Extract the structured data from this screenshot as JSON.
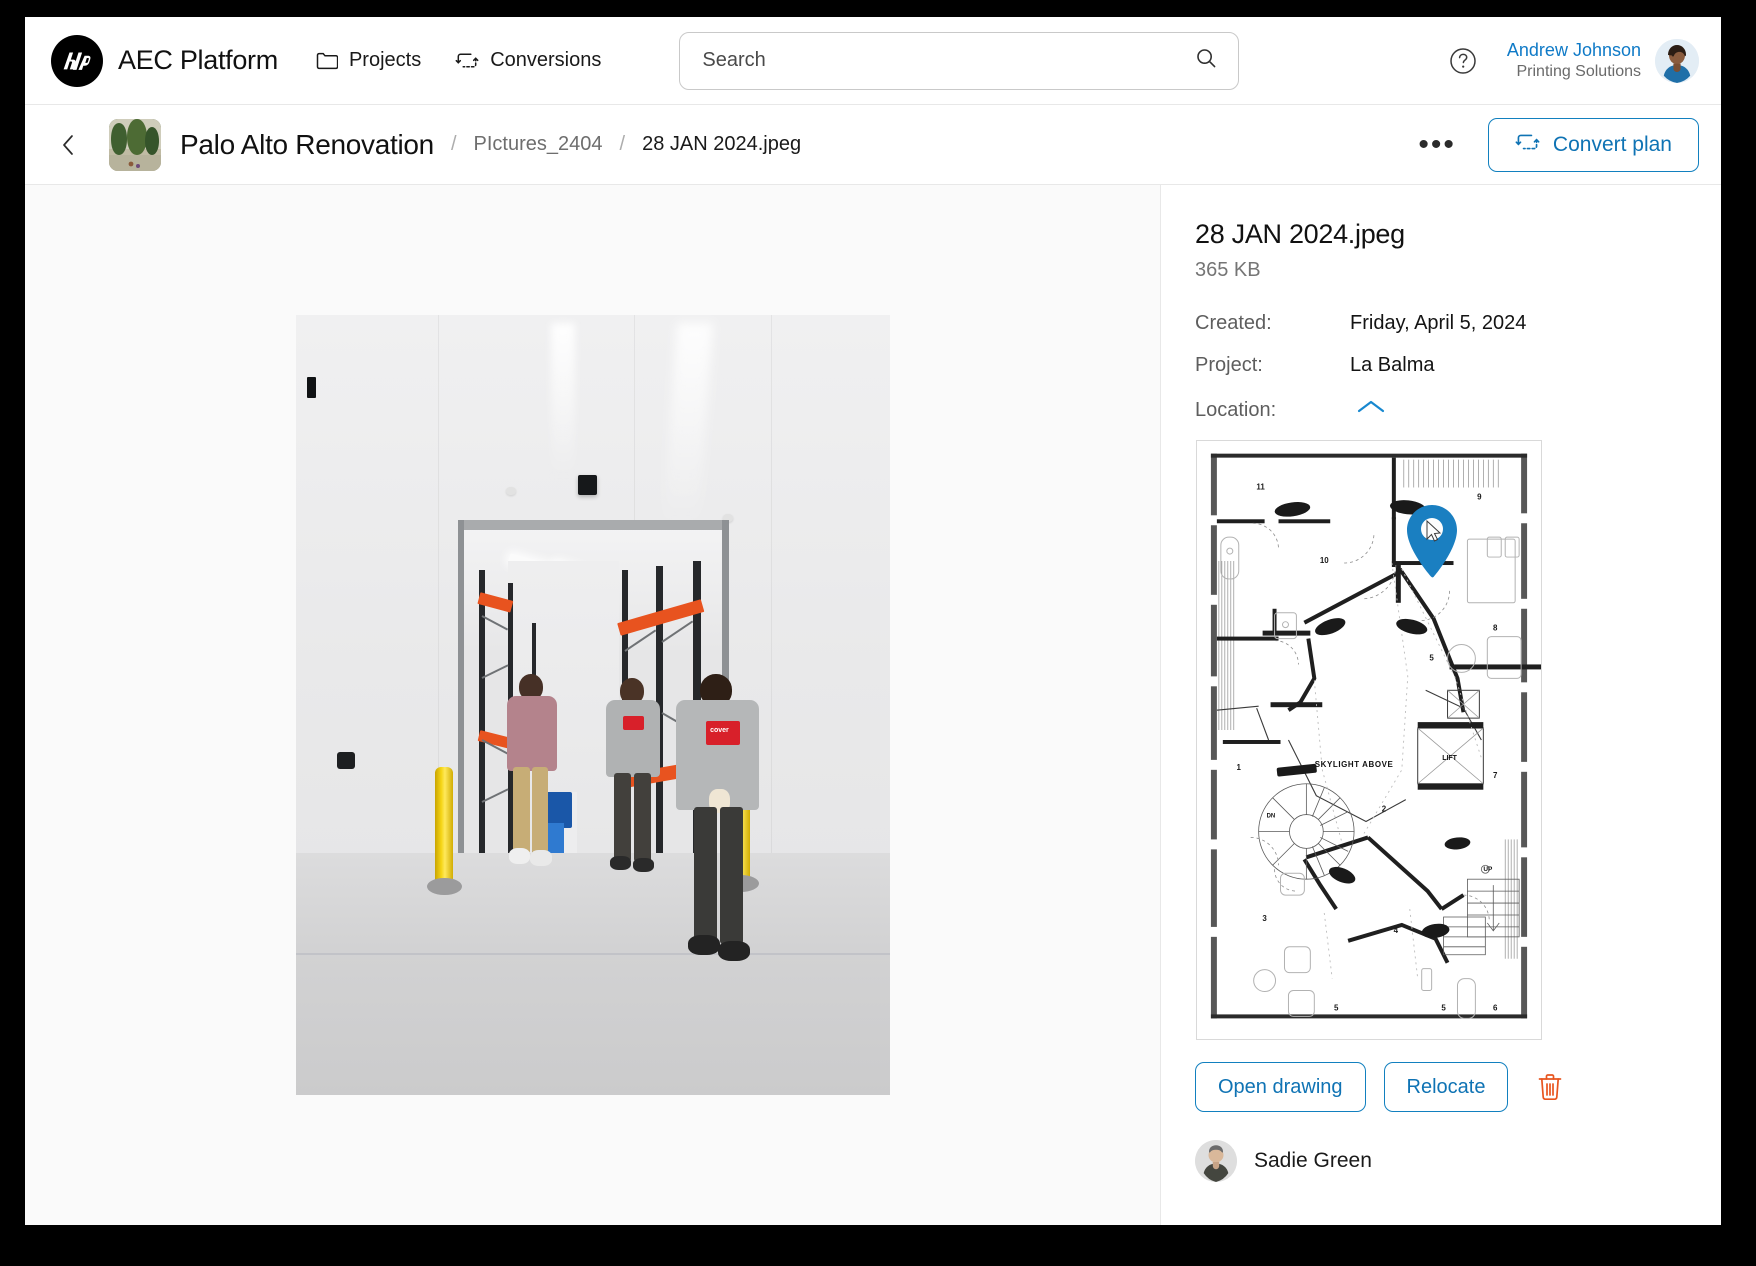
{
  "header": {
    "brand": "AEC Platform",
    "logo_alt": "hp",
    "nav": [
      {
        "label": "Projects",
        "icon": "folder-icon"
      },
      {
        "label": "Conversions",
        "icon": "convert-icon"
      }
    ],
    "search": {
      "placeholder": "Search",
      "value": "",
      "icon": "search-icon"
    },
    "help_icon": "help-circle-icon",
    "user": {
      "name": "Andrew Johnson",
      "org": "Printing Solutions"
    }
  },
  "breadcrumb": {
    "back_icon": "chevron-left-icon",
    "project": "Palo Alto Renovation",
    "separator": "/",
    "folder": "PIctures_2404",
    "file": "28 JAN 2024.jpeg",
    "more_label": "•••",
    "convert_button": "Convert plan",
    "convert_icon": "convert-icon"
  },
  "details": {
    "file_name": "28 JAN 2024.jpeg",
    "file_size": "365 KB",
    "rows": [
      {
        "label": "Created:",
        "value": "Friday, April 5, 2024"
      },
      {
        "label": "Project:",
        "value": "La Balma"
      }
    ],
    "location_label": "Location:",
    "location_toggle_icon": "chevron-up-icon",
    "buttons": {
      "open_drawing": "Open drawing",
      "relocate": "Relocate",
      "delete_icon": "trash-icon"
    },
    "owner": {
      "name": "Sadie Green"
    }
  },
  "floorplan": {
    "room_numbers": [
      "1",
      "2",
      "3",
      "4",
      "5",
      "5",
      "5",
      "6",
      "7",
      "8",
      "9",
      "10",
      "11"
    ],
    "labels": [
      "SKYLIGHT ABOVE",
      "LIFT",
      "UP",
      "DN"
    ],
    "pin_icon": "map-pin-icon",
    "cursor_icon": "cursor-arrow-icon"
  },
  "colors": {
    "accent_blue": "#0f73b4",
    "pin_blue": "#1a7fc1",
    "delete_orange": "#e8551f",
    "user_link": "#0f7ac7"
  }
}
